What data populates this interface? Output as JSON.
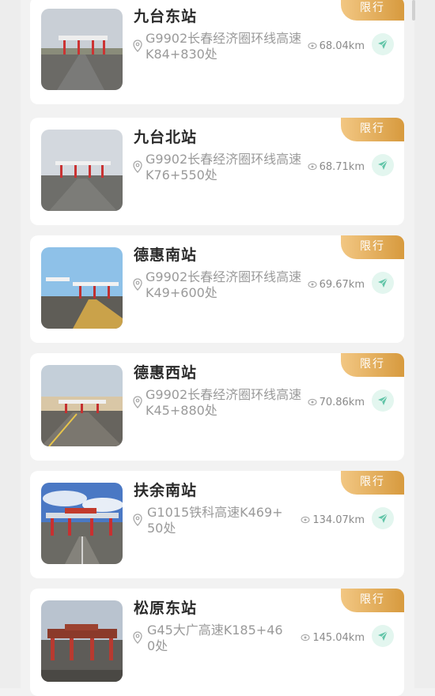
{
  "badge_label": "限行",
  "colors": {
    "accent_badge_start": "#f2c783",
    "accent_badge_end": "#d79a3e",
    "nav_button_bg": "#e3f6ef",
    "nav_button_icon": "#62c5a8"
  },
  "icons": {
    "location": "map-pin-icon",
    "distance": "eye-icon",
    "navigate": "send-arrow-icon"
  },
  "stations": [
    {
      "name": "九台东站",
      "address": "G9902长春经济圈环线高速K84+830处",
      "distance": "68.04km"
    },
    {
      "name": "九台北站",
      "address": "G9902长春经济圈环线高速K76+550处",
      "distance": "68.71km"
    },
    {
      "name": "德惠南站",
      "address": "G9902长春经济圈环线高速K49+600处",
      "distance": "69.67km"
    },
    {
      "name": "德惠西站",
      "address": "G9902长春经济圈环线高速K45+880处",
      "distance": "70.86km"
    },
    {
      "name": "扶余南站",
      "address": "G1015铁科高速K469+50处",
      "distance": "134.07km"
    },
    {
      "name": "松原东站",
      "address": "G45大广高速K185+460处",
      "distance": "145.04km"
    }
  ]
}
